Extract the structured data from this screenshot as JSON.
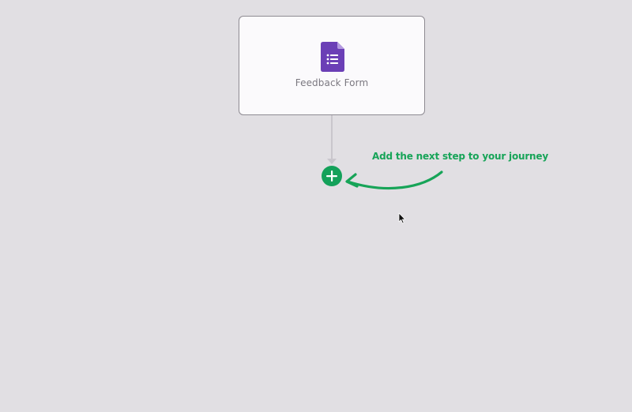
{
  "canvas": {
    "background_color": "#e1dfe3"
  },
  "node": {
    "label": "Feedback Form",
    "icon": "google-forms-icon",
    "icon_color": "#6b3fb6"
  },
  "add_step": {
    "icon": "plus-icon",
    "color": "#14a15a"
  },
  "hint": {
    "text": "Add the next step to your journey",
    "color": "#17a458",
    "icon": "curved-arrow-icon"
  },
  "pointer": {
    "icon": "mouse-cursor-icon"
  }
}
